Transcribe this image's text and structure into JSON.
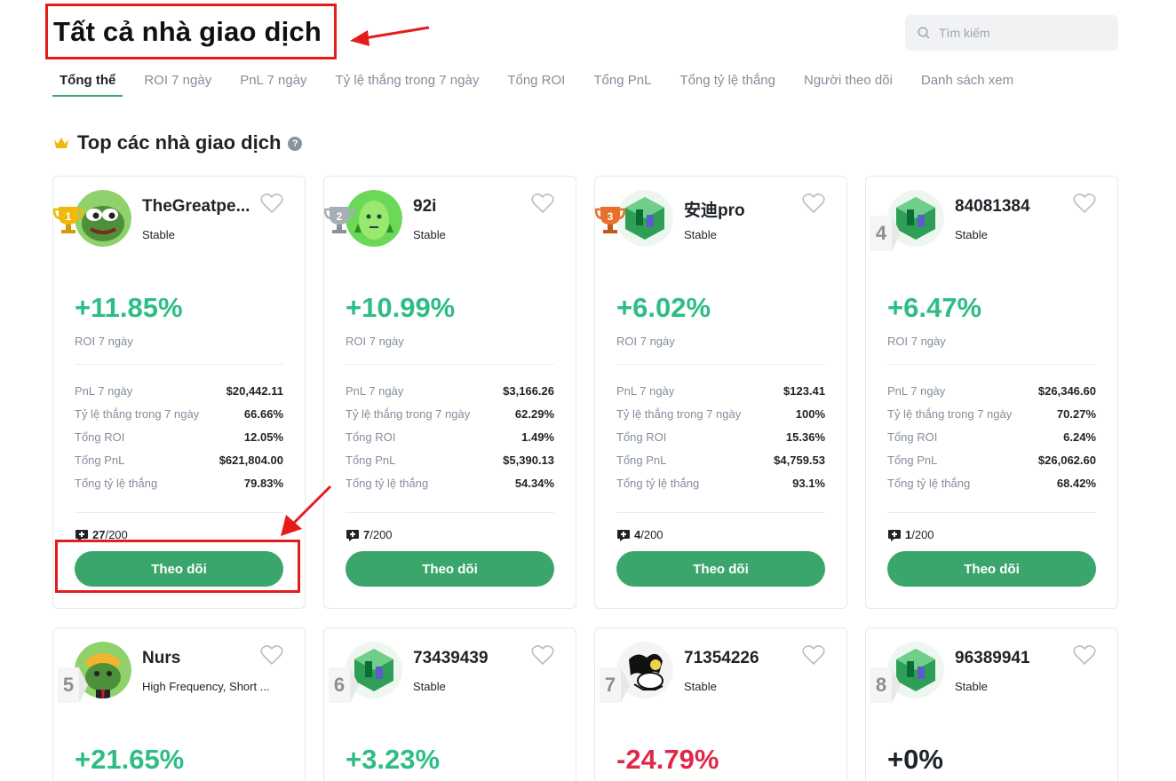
{
  "header": {
    "title": "Tất cả nhà giao dịch"
  },
  "search": {
    "placeholder": "Tìm kiếm",
    "icon": "search-icon"
  },
  "tabs": [
    {
      "label": "Tổng thể",
      "active": true
    },
    {
      "label": "ROI 7 ngày"
    },
    {
      "label": "PnL 7 ngày"
    },
    {
      "label": "Tỷ lệ thắng trong 7 ngày"
    },
    {
      "label": "Tổng ROI"
    },
    {
      "label": "Tổng PnL"
    },
    {
      "label": "Tổng tỷ lệ thắng"
    },
    {
      "label": "Người theo dõi"
    },
    {
      "label": "Danh sách xem"
    }
  ],
  "section": {
    "title": "Top các nhà giao dịch",
    "help": "?"
  },
  "labels": {
    "roi_7d": "ROI 7 ngày",
    "pnl_7d": "PnL 7 ngày",
    "winrate_7d": "Tỷ lệ thắng trong 7 ngày",
    "total_roi": "Tổng ROI",
    "total_pnl": "Tổng PnL",
    "total_winrate": "Tổng tỷ lệ thắng",
    "follow": "Theo dõi",
    "slots_sep": "/200"
  },
  "colors": {
    "accent": "#3ba66b",
    "positive": "#2ebd85",
    "negative": "#e0294a",
    "highlight": "#e51c1c"
  },
  "traders": [
    {
      "rank": "1",
      "name": "TheGreatpe...",
      "tag": "Stable",
      "roi": "+11.85%",
      "pnl7": "$20,442.11",
      "win7": "66.66%",
      "troi": "12.05%",
      "tpnl": "$621,804.00",
      "twin": "79.83%",
      "slots": "27"
    },
    {
      "rank": "2",
      "name": "92i",
      "tag": "Stable",
      "roi": "+10.99%",
      "pnl7": "$3,166.26",
      "win7": "62.29%",
      "troi": "1.49%",
      "tpnl": "$5,390.13",
      "twin": "54.34%",
      "slots": "7"
    },
    {
      "rank": "3",
      "name": "安迪pro",
      "tag": "Stable",
      "roi": "+6.02%",
      "pnl7": "$123.41",
      "win7": "100%",
      "troi": "15.36%",
      "tpnl": "$4,759.53",
      "twin": "93.1%",
      "slots": "4"
    },
    {
      "rank": "4",
      "name": "84081384",
      "tag": "Stable",
      "roi": "+6.47%",
      "pnl7": "$26,346.60",
      "win7": "70.27%",
      "troi": "6.24%",
      "tpnl": "$26,062.60",
      "twin": "68.42%",
      "slots": "1"
    },
    {
      "rank": "5",
      "name": "Nurs",
      "tag": "High Frequency, Short ...",
      "roi": "+21.65%"
    },
    {
      "rank": "6",
      "name": "73439439",
      "tag": "Stable",
      "roi": "+3.23%"
    },
    {
      "rank": "7",
      "name": "71354226",
      "tag": "Stable",
      "roi": "-24.79%"
    },
    {
      "rank": "8",
      "name": "96389941",
      "tag": "Stable",
      "roi": "+0%"
    }
  ]
}
